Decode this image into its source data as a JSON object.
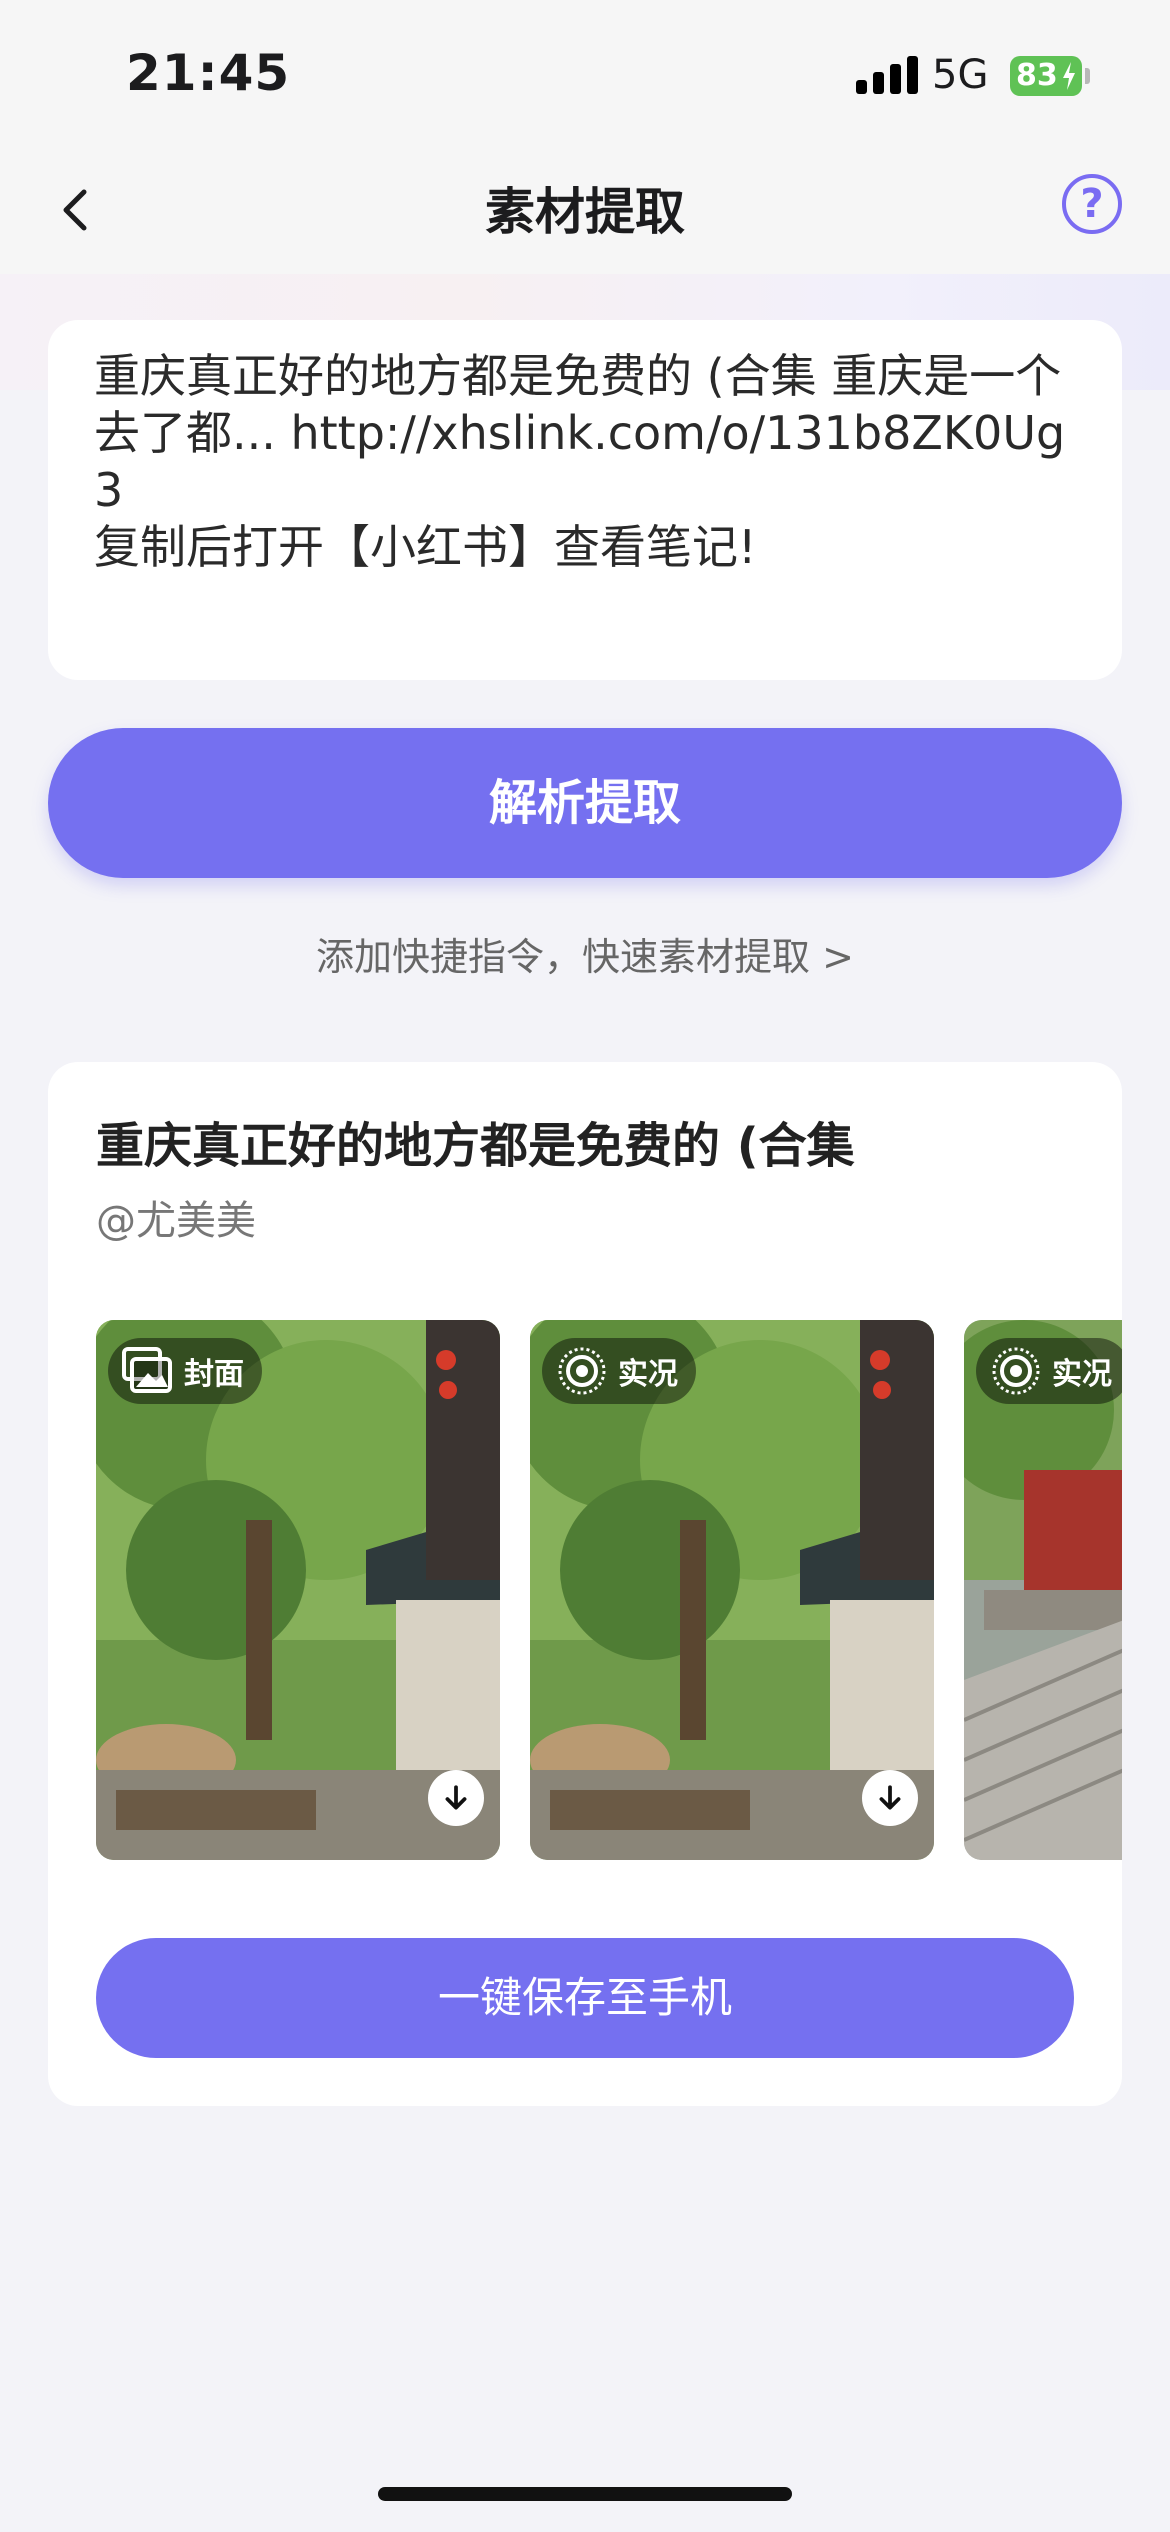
{
  "status_bar": {
    "time": "21:45",
    "network": "5G",
    "battery": "83"
  },
  "nav": {
    "title": "素材提取"
  },
  "input": {
    "text": "重庆真正好的地方都是免费的 (合集 重庆是一个去了都... http://xhslink.com/o/131b8ZK0Ug3\n复制后打开【小红书】查看笔记!"
  },
  "parse_button": "解析提取",
  "shortcut_link": "添加快捷指令，快速素材提取 >",
  "result": {
    "title": "重庆真正好的地方都是免费的 (合集",
    "author": "@尤美美",
    "thumbnails": [
      {
        "badge": "封面",
        "icon": "image-stack-icon"
      },
      {
        "badge": "实况",
        "icon": "live-photo-icon"
      },
      {
        "badge": "实况",
        "icon": "live-photo-icon"
      }
    ],
    "save_button": "一键保存至手机"
  },
  "colors": {
    "accent": "#7570f0",
    "background": "#f3f3f8"
  }
}
